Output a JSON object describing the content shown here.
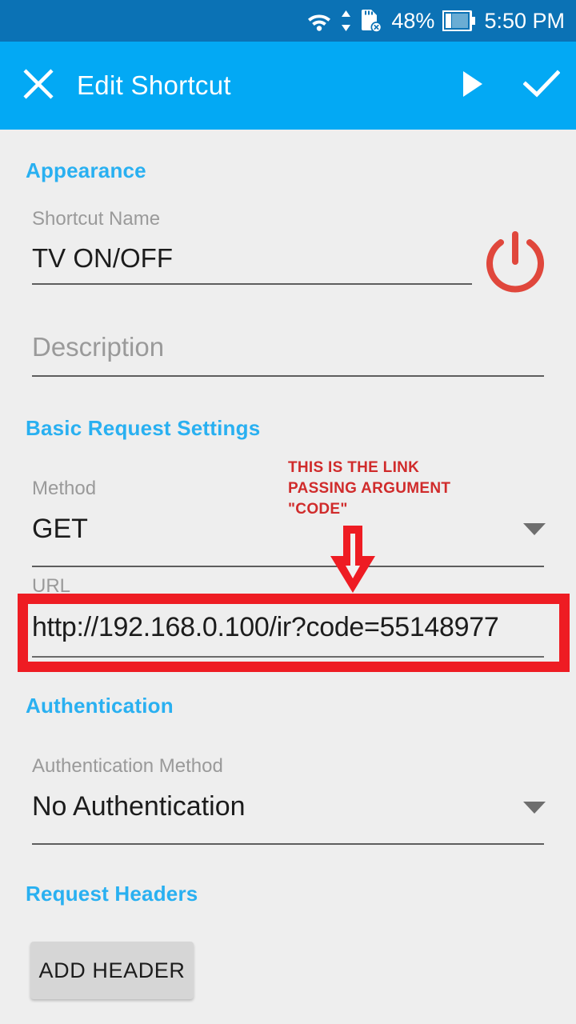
{
  "status_bar": {
    "wifi_icon": "wifi-icon",
    "data_transfer_icon": "data-transfer-arrows-icon",
    "sdcard_icon": "sdcard-removed-icon",
    "battery_percent": "48%",
    "battery_icon": "battery-icon",
    "time": "5:50 PM",
    "background_color": "#0b72b5"
  },
  "toolbar": {
    "close_icon": "close-icon",
    "title": "Edit Shortcut",
    "run_icon": "play-icon",
    "save_icon": "check-icon",
    "background_color": "#03a9f4"
  },
  "sections": {
    "appearance": {
      "title": "Appearance",
      "shortcut_name_label": "Shortcut Name",
      "shortcut_name_value": "TV ON/OFF",
      "icon_name": "power-icon",
      "icon_color": "#e0473c",
      "description_placeholder": "Description",
      "description_value": ""
    },
    "basic_request": {
      "title": "Basic Request Settings",
      "method_label": "Method",
      "method_value": "GET",
      "url_label": "URL",
      "url_value": "http://192.168.0.100/ir?code=55148977"
    },
    "authentication": {
      "title": "Authentication",
      "method_label": "Authentication Method",
      "method_value": "No Authentication"
    },
    "request_headers": {
      "title": "Request Headers",
      "add_header_label": "ADD HEADER"
    }
  },
  "annotations": {
    "callout_text": "THIS IS THE LINK\nPASSING ARGUMENT\n\"CODE\"",
    "callout_color": "#d02b2b",
    "arrow_name": "red-down-arrow",
    "highlight_box_color": "#ee1c23"
  },
  "theme": {
    "accent_blue": "#29b0f1",
    "background": "#eeeeee",
    "text_primary": "#1c1c1c",
    "text_secondary": "#9a9a9a"
  }
}
